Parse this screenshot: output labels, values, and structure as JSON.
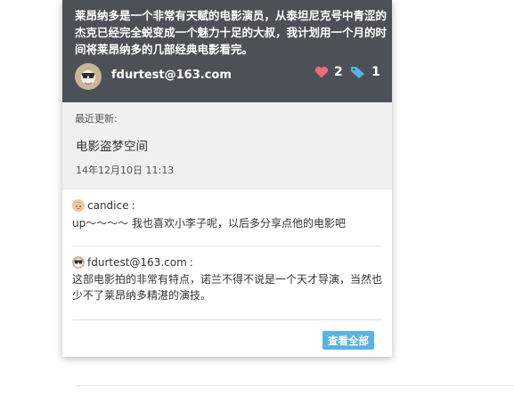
{
  "post": {
    "description": "莱昂纳多是一个非常有天赋的电影演员，从泰坦尼克号中青涩的杰克已经完全蜕变成一个魅力十足的大叔，我计划用一个月的时间将莱昂纳多的几部经典电影看完。",
    "author": "fdurtest@163.com",
    "likes": "2",
    "tags": "1",
    "icons": {
      "likes": "heart-icon",
      "tags": "tag-icon"
    },
    "colors": {
      "header_bg": "#4c5057",
      "heart": "#ee6a77",
      "tag": "#58b2e0"
    }
  },
  "update": {
    "label": "最近更新:",
    "title": "电影盗梦空间",
    "date": "14年12月10日 11:13"
  },
  "comments": [
    {
      "author": "candice",
      "colon": ":",
      "text": "up～～～～  我也喜欢小李子呢，以后多分享点他的电影吧"
    },
    {
      "author": "fdurtest@163.com",
      "colon": ":",
      "text": "这部电影拍的非常有特点，诺兰不得不说是一个天才导演，当然也少不了莱昂纳多精湛的演技。"
    }
  ],
  "view_all": {
    "label": "查看全部",
    "color": "#5bb3e1"
  }
}
